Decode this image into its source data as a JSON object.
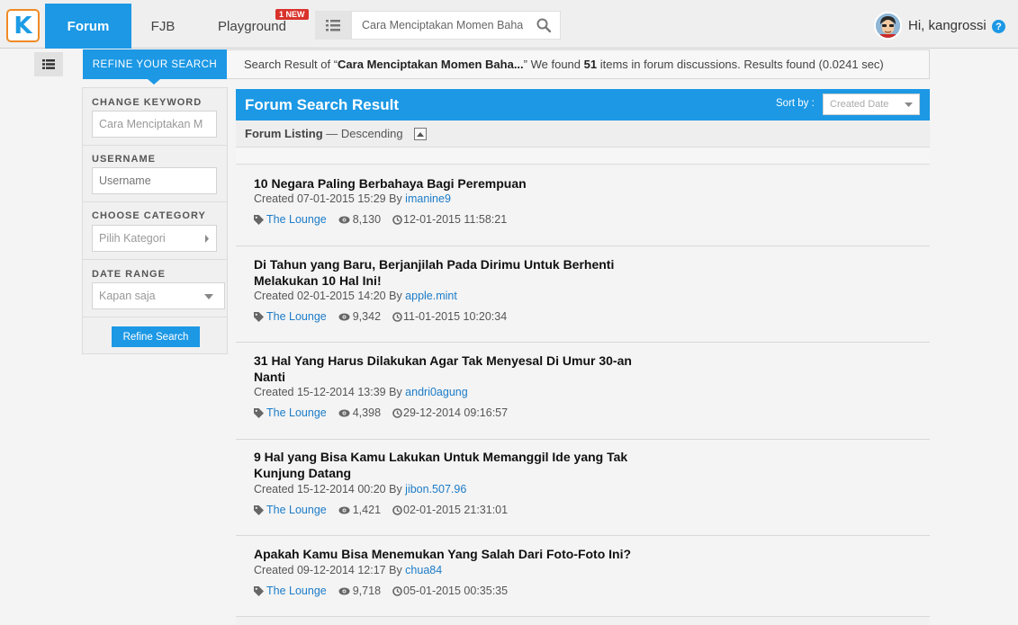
{
  "nav": {
    "logo_letter": "K",
    "forum": "Forum",
    "fjb": "FJB",
    "playground": "Playground",
    "new_badge": "1 NEW",
    "search_value": "Cara Menciptakan Momen Baha",
    "greeting": "Hi, kangrossi",
    "help": "?"
  },
  "summary": {
    "refine_tab": "REFINE YOUR SEARCH",
    "prefix": "Search Result of “",
    "query": "Cara Menciptakan Momen Baha...",
    "mid": "” We found ",
    "count": "51",
    "suffix": " items in forum discussions. Results found (0.0241 sec)"
  },
  "sidebar": {
    "keyword_label": "CHANGE KEYWORD",
    "keyword_value": "Cara Menciptakan M",
    "username_label": "USERNAME",
    "username_placeholder": "Username",
    "category_label": "CHOOSE CATEGORY",
    "category_value": "Pilih Kategori",
    "date_label": "DATE RANGE",
    "date_value": "Kapan saja",
    "refine_button": "Refine Search"
  },
  "main": {
    "title": "Forum Search Result",
    "sort_label": "Sort by :",
    "sort_value": "Created Date",
    "listing_label": "Forum Listing",
    "listing_order": " — Descending"
  },
  "results": [
    {
      "title": "10 Negara Paling Berbahaya Bagi Perempuan",
      "created": "Created 07-01-2015 15:29 By ",
      "author": "imanine9",
      "category": "The Lounge",
      "views": "8,130",
      "last_post": "12-01-2015 11:58:21"
    },
    {
      "title": "Di Tahun yang Baru, Berjanjilah Pada Dirimu Untuk Berhenti Melakukan 10 Hal Ini!",
      "created": "Created 02-01-2015 14:20 By ",
      "author": "apple.mint",
      "category": "The Lounge",
      "views": "9,342",
      "last_post": "11-01-2015 10:20:34"
    },
    {
      "title": "31 Hal Yang Harus Dilakukan Agar Tak Menyesal Di Umur 30-an Nanti",
      "created": "Created 15-12-2014 13:39 By ",
      "author": "andri0agung",
      "category": "The Lounge",
      "views": "4,398",
      "last_post": "29-12-2014 09:16:57"
    },
    {
      "title": "9 Hal yang Bisa Kamu Lakukan Untuk Memanggil Ide yang Tak Kunjung Datang",
      "created": "Created 15-12-2014 00:20 By ",
      "author": "jibon.507.96",
      "category": "The Lounge",
      "views": "1,421",
      "last_post": "02-01-2015 21:31:01"
    },
    {
      "title": "Apakah Kamu Bisa Menemukan Yang Salah Dari Foto-Foto Ini?",
      "created": "Created 09-12-2014 12:17 By ",
      "author": "chua84",
      "category": "The Lounge",
      "views": "9,718",
      "last_post": "05-01-2015 00:35:35"
    }
  ]
}
